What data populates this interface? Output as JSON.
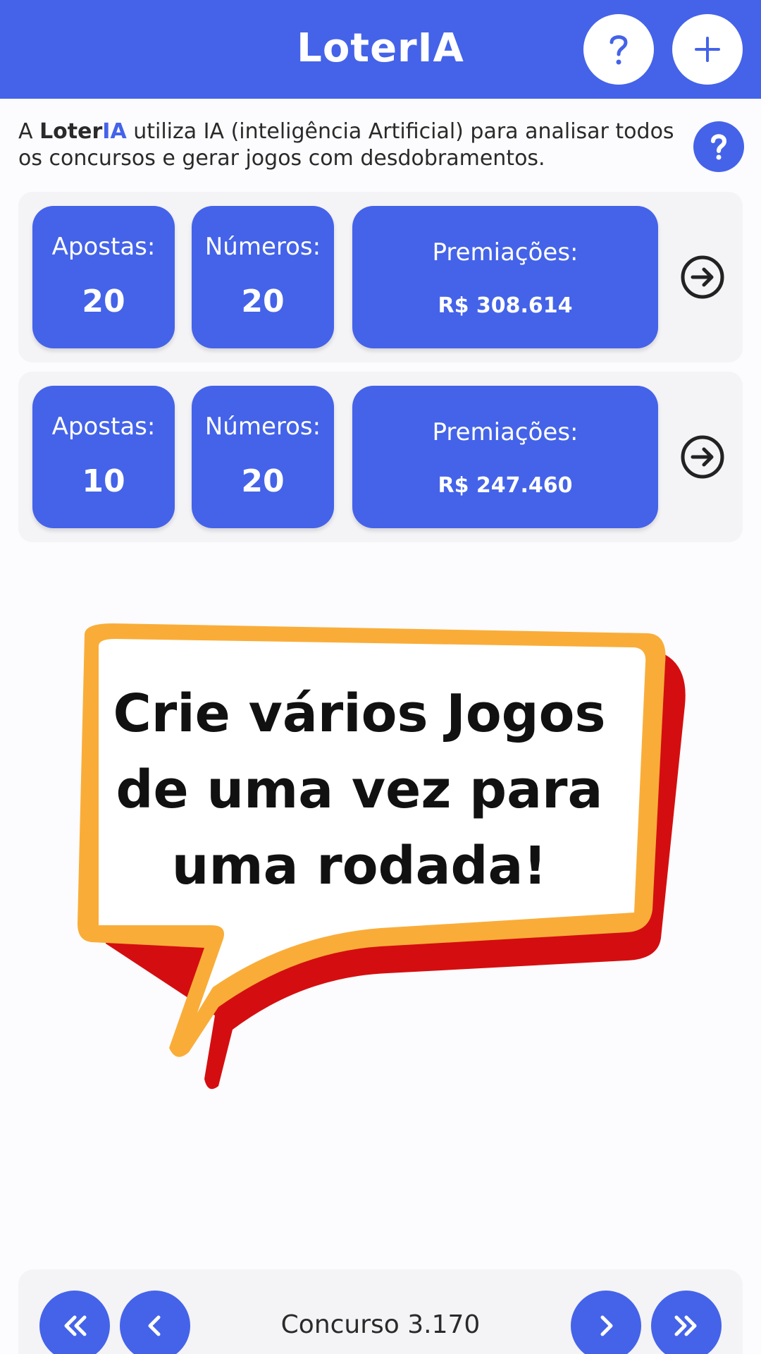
{
  "appbar": {
    "title": "LoterIA",
    "help_icon": "question-mark-icon",
    "add_icon": "plus-icon"
  },
  "intro": {
    "prefix": "A ",
    "brand_main": "Loter",
    "brand_ia": "IA",
    "text": " utiliza IA (inteligência Artificial) para analisar todos os concursos e gerar jogos com desdobramentos.",
    "help_icon": "question-mark-icon"
  },
  "games": [
    {
      "apostas_label": "Apostas:",
      "apostas_value": "20",
      "numeros_label": "Números:",
      "numeros_value": "20",
      "premiacoes_label": "Premiações:",
      "premiacoes_value": "R$ 308.614"
    },
    {
      "apostas_label": "Apostas:",
      "apostas_value": "10",
      "numeros_label": "Números:",
      "numeros_value": "20",
      "premiacoes_label": "Premiações:",
      "premiacoes_value": "R$ 247.460"
    }
  ],
  "promo": {
    "line1": "Crie vários Jogos",
    "line2": "de uma vez para",
    "line3": "uma rodada!"
  },
  "footer": {
    "concurso_label": "Concurso 3.170",
    "first_icon": "double-chevron-left-icon",
    "prev_icon": "chevron-left-icon",
    "next_icon": "chevron-right-icon",
    "last_icon": "double-chevron-right-icon"
  },
  "colors": {
    "primary": "#4463e9",
    "bubble_orange": "#f9ad38",
    "bubble_red": "#d40e10"
  }
}
